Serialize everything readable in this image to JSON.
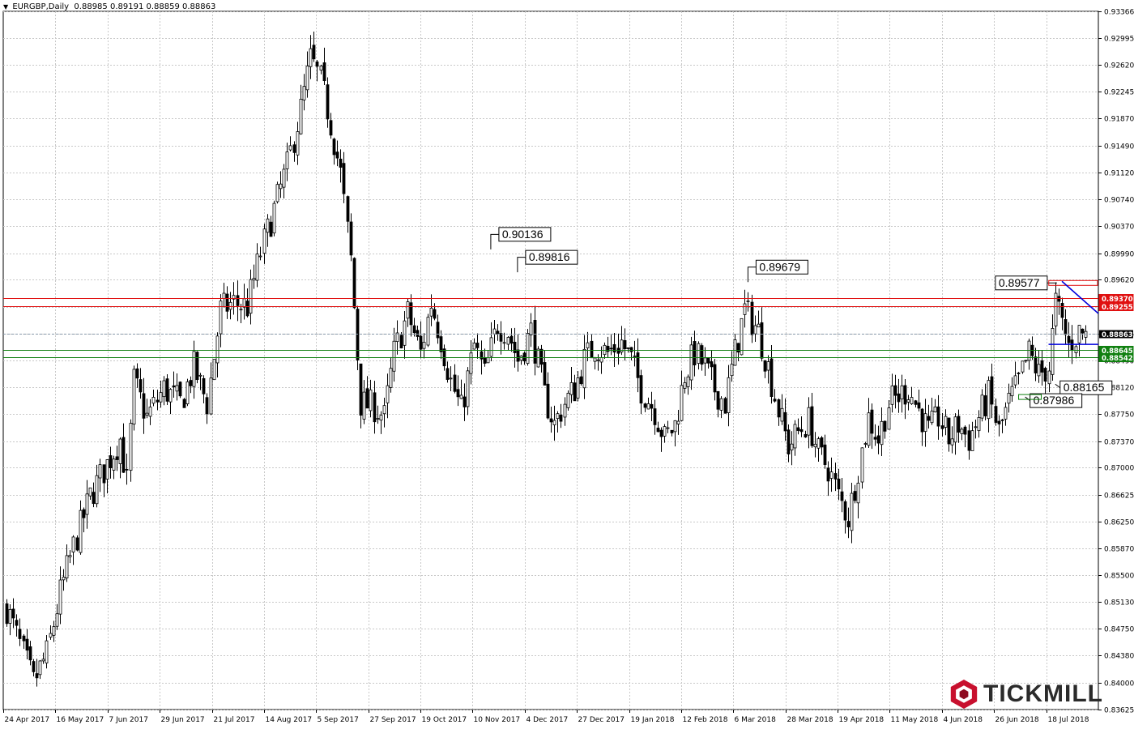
{
  "header": {
    "symbol": "EURGBP,Daily",
    "ohlc": "0.88985 0.89191 0.88859 0.88863"
  },
  "brand": {
    "name": "TICKMILL",
    "color": "#c8102e"
  },
  "colors": {
    "grid": "#c8c8c8",
    "axis": "#000000",
    "bull": "#ffffff",
    "bear": "#000000",
    "resistance": "#e01010",
    "support": "#108010",
    "trendline": "#0000dd",
    "current": "#8899aa"
  },
  "chart_data": {
    "type": "candlestick",
    "symbol": "EURGBP",
    "timeframe": "Daily",
    "ylim": [
      0.83625,
      0.93366
    ],
    "y_ticks": [
      "0.93366",
      "0.92995",
      "0.92620",
      "0.92245",
      "0.91870",
      "0.91490",
      "0.91120",
      "0.90740",
      "0.90370",
      "0.89990",
      "0.89620",
      "0.89245",
      "0.88865",
      "0.88490",
      "0.88120",
      "0.87750",
      "0.87370",
      "0.87000",
      "0.86625",
      "0.86250",
      "0.85870",
      "0.85500",
      "0.85130",
      "0.84750",
      "0.84380",
      "0.84000",
      "0.83625"
    ],
    "x_ticks": [
      "24 Apr 2017",
      "16 May 2017",
      "7 Jun 2017",
      "29 Jun 2017",
      "21 Jul 2017",
      "14 Aug 2017",
      "5 Sep 2017",
      "27 Sep 2017",
      "19 Oct 2017",
      "10 Nov 2017",
      "4 Dec 2017",
      "27 Dec 2017",
      "19 Jan 2018",
      "12 Feb 2018",
      "6 Mar 2018",
      "28 Mar 2018",
      "19 Apr 2018",
      "11 May 2018",
      "4 Jun 2018",
      "26 Jun 2018",
      "18 Jul 2018"
    ],
    "anchors": [
      [
        0,
        0.8505
      ],
      [
        8,
        0.84
      ],
      [
        12,
        0.844
      ],
      [
        16,
        0.8525
      ],
      [
        20,
        0.859
      ],
      [
        25,
        0.866
      ],
      [
        30,
        0.8705
      ],
      [
        34,
        0.874
      ],
      [
        36,
        0.868
      ],
      [
        38,
        0.882
      ],
      [
        42,
        0.877
      ],
      [
        47,
        0.881
      ],
      [
        52,
        0.879
      ],
      [
        56,
        0.884
      ],
      [
        60,
        0.879
      ],
      [
        64,
        0.892
      ],
      [
        68,
        0.893
      ],
      [
        72,
        0.8925
      ],
      [
        76,
        0.9
      ],
      [
        80,
        0.906
      ],
      [
        84,
        0.912
      ],
      [
        88,
        0.92
      ],
      [
        91,
        0.927
      ],
      [
        94,
        0.924
      ],
      [
        97,
        0.918
      ],
      [
        100,
        0.911
      ],
      [
        103,
        0.899
      ],
      [
        106,
        0.879
      ],
      [
        110,
        0.8785
      ],
      [
        113,
        0.877
      ],
      [
        116,
        0.886
      ],
      [
        120,
        0.8915
      ],
      [
        124,
        0.886
      ],
      [
        127,
        0.893
      ],
      [
        130,
        0.888
      ],
      [
        133,
        0.882
      ],
      [
        136,
        0.878
      ],
      [
        140,
        0.887
      ],
      [
        143,
        0.883
      ],
      [
        147,
        0.89
      ],
      [
        150,
        0.889
      ],
      [
        153,
        0.885
      ],
      [
        157,
        0.889
      ],
      [
        161,
        0.88
      ],
      [
        164,
        0.876
      ],
      [
        167,
        0.879
      ],
      [
        170,
        0.881
      ],
      [
        173,
        0.885
      ],
      [
        176,
        0.887
      ],
      [
        180,
        0.886
      ],
      [
        184,
        0.8875
      ],
      [
        187,
        0.885
      ],
      [
        190,
        0.881
      ],
      [
        194,
        0.878
      ],
      [
        197,
        0.874
      ],
      [
        200,
        0.876
      ],
      [
        203,
        0.883
      ],
      [
        206,
        0.886
      ],
      [
        209,
        0.884
      ],
      [
        212,
        0.881
      ],
      [
        215,
        0.879
      ],
      [
        218,
        0.886
      ],
      [
        221,
        0.892
      ],
      [
        225,
        0.889
      ],
      [
        228,
        0.884
      ],
      [
        231,
        0.878
      ],
      [
        234,
        0.873
      ],
      [
        237,
        0.875
      ],
      [
        240,
        0.8765
      ],
      [
        243,
        0.872
      ],
      [
        246,
        0.87
      ],
      [
        249,
        0.866
      ],
      [
        252,
        0.863
      ],
      [
        255,
        0.87
      ],
      [
        258,
        0.877
      ],
      [
        261,
        0.874
      ],
      [
        264,
        0.879
      ],
      [
        267,
        0.88
      ],
      [
        270,
        0.881
      ],
      [
        273,
        0.878
      ],
      [
        276,
        0.875
      ],
      [
        279,
        0.877
      ],
      [
        282,
        0.874
      ],
      [
        285,
        0.876
      ],
      [
        288,
        0.874
      ],
      [
        291,
        0.877
      ],
      [
        294,
        0.88
      ],
      [
        297,
        0.875
      ],
      [
        300,
        0.879
      ],
      [
        303,
        0.882
      ],
      [
        306,
        0.886
      ],
      [
        309,
        0.883
      ],
      [
        312,
        0.884
      ],
      [
        314,
        0.893
      ],
      [
        316,
        0.89
      ],
      [
        318,
        0.887
      ],
      [
        321,
        0.889
      ],
      [
        323,
        0.8886
      ]
    ],
    "resistance_lines": [
      {
        "label": "0.89370",
        "value": 0.8937
      },
      {
        "label": "0.89255",
        "value": 0.89255
      }
    ],
    "support_lines": [
      {
        "label": "0.88645",
        "value": 0.88645
      },
      {
        "label": "0.88542",
        "value": 0.88542
      }
    ],
    "current_price": {
      "label": "0.88863",
      "value": 0.88863
    },
    "annotations": [
      {
        "text": "0.90136",
        "value": 0.90136,
        "bar": 145,
        "side": "above"
      },
      {
        "text": "0.89816",
        "value": 0.89816,
        "bar": 153,
        "side": "above"
      },
      {
        "text": "0.89679",
        "value": 0.89679,
        "bar": 222,
        "side": "above"
      },
      {
        "text": "0.89577",
        "value": 0.89577,
        "bar": 315,
        "side": "left"
      },
      {
        "text": "0.88165",
        "value": 0.88165,
        "bar": 314,
        "side": "below"
      },
      {
        "text": "0.87986",
        "value": 0.87986,
        "bar": 305,
        "side": "below"
      }
    ]
  }
}
